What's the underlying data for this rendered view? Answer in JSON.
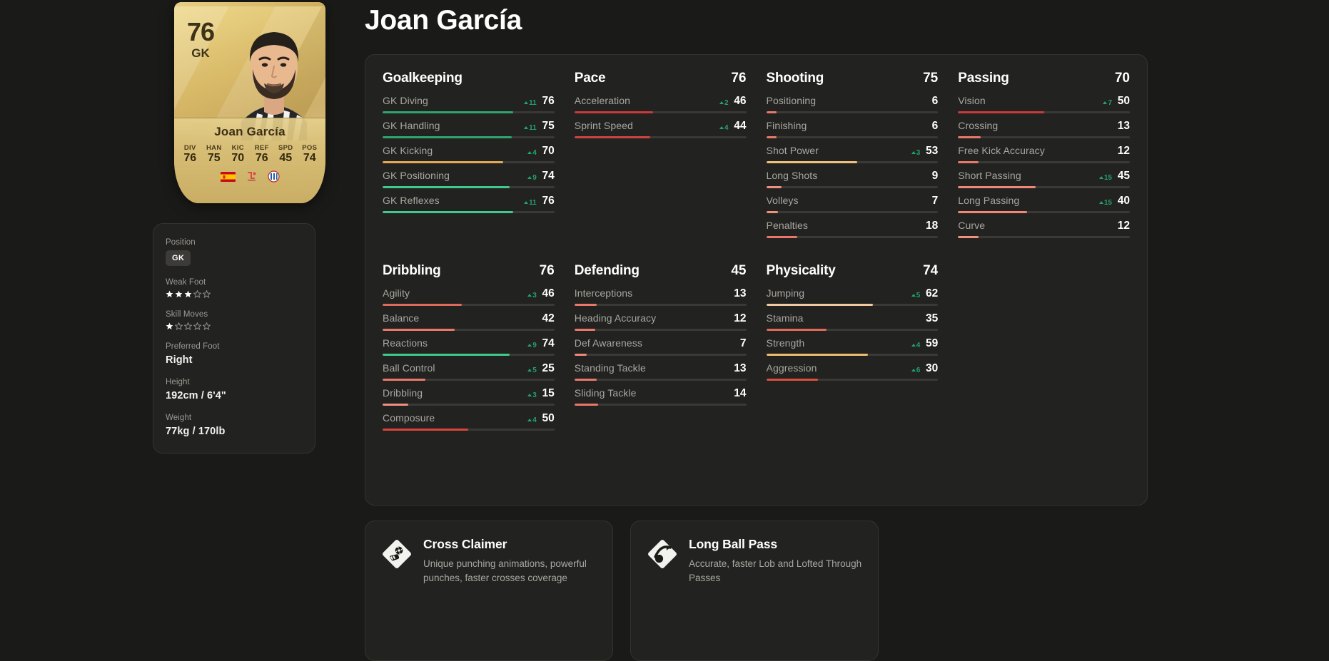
{
  "player": {
    "name": "Joan García",
    "card": {
      "rating": "76",
      "position": "GK",
      "name": "Joan García",
      "stats": [
        {
          "label": "DIV",
          "value": "76"
        },
        {
          "label": "HAN",
          "value": "75"
        },
        {
          "label": "KIC",
          "value": "70"
        },
        {
          "label": "REF",
          "value": "76"
        },
        {
          "label": "SPD",
          "value": "45"
        },
        {
          "label": "POS",
          "value": "74"
        }
      ],
      "badges": [
        "spain-flag-icon",
        "laliga-logo-icon",
        "espanyol-crest-icon"
      ]
    }
  },
  "info": {
    "position_label": "Position",
    "position_value": "GK",
    "weak_foot_label": "Weak Foot",
    "weak_foot_value": 3,
    "skill_moves_label": "Skill Moves",
    "skill_moves_value": 1,
    "star_max": 5,
    "preferred_foot_label": "Preferred Foot",
    "preferred_foot_value": "Right",
    "height_label": "Height",
    "height_value": "192cm / 6'4\"",
    "weight_label": "Weight",
    "weight_value": "77kg / 170lb"
  },
  "colors": {
    "green": "#2fa66e",
    "bright_green": "#3fc98a",
    "orange": "#e0a857",
    "light_orange": "#f0c07e",
    "red": "#c93a3a",
    "salmon": "#e8796a",
    "light_salmon": "#f0917f",
    "track": "#3a3935",
    "panel": "#222220",
    "background": "#1a1a18",
    "delta_green": "#23a36a"
  },
  "categories": [
    {
      "name": "Goalkeeping",
      "total": "",
      "stats": [
        {
          "name": "GK Diving",
          "value": 76,
          "delta": 11,
          "color": "#2fa66e"
        },
        {
          "name": "GK Handling",
          "value": 75,
          "delta": 11,
          "color": "#2fa66e"
        },
        {
          "name": "GK Kicking",
          "value": 70,
          "delta": 4,
          "color": "#e0a857"
        },
        {
          "name": "GK Positioning",
          "value": 74,
          "delta": 9,
          "color": "#3fc98a"
        },
        {
          "name": "GK Reflexes",
          "value": 76,
          "delta": 11,
          "color": "#3fc98a"
        }
      ]
    },
    {
      "name": "Pace",
      "total": "76",
      "stats": [
        {
          "name": "Acceleration",
          "value": 46,
          "delta": 2,
          "color": "#c93a3a"
        },
        {
          "name": "Sprint Speed",
          "value": 44,
          "delta": 4,
          "color": "#cf4343"
        }
      ]
    },
    {
      "name": "Shooting",
      "total": "75",
      "stats": [
        {
          "name": "Positioning",
          "value": 6,
          "delta": null,
          "color": "#e8796a"
        },
        {
          "name": "Finishing",
          "value": 6,
          "delta": null,
          "color": "#e8796a"
        },
        {
          "name": "Shot Power",
          "value": 53,
          "delta": 3,
          "color": "#f0c07e"
        },
        {
          "name": "Long Shots",
          "value": 9,
          "delta": null,
          "color": "#f0917f"
        },
        {
          "name": "Volleys",
          "value": 7,
          "delta": null,
          "color": "#f0917f"
        },
        {
          "name": "Penalties",
          "value": 18,
          "delta": null,
          "color": "#e8796a"
        }
      ]
    },
    {
      "name": "Passing",
      "total": "70",
      "stats": [
        {
          "name": "Vision",
          "value": 50,
          "delta": 7,
          "color": "#c93a3a"
        },
        {
          "name": "Crossing",
          "value": 13,
          "delta": null,
          "color": "#e8796a"
        },
        {
          "name": "Free Kick Accuracy",
          "value": 12,
          "delta": null,
          "color": "#e8796a"
        },
        {
          "name": "Short Passing",
          "value": 45,
          "delta": 15,
          "color": "#ef8878"
        },
        {
          "name": "Long Passing",
          "value": 40,
          "delta": 15,
          "color": "#ef8878"
        },
        {
          "name": "Curve",
          "value": 12,
          "delta": null,
          "color": "#f0917f"
        }
      ]
    },
    {
      "name": "Dribbling",
      "total": "76",
      "stats": [
        {
          "name": "Agility",
          "value": 46,
          "delta": 3,
          "color": "#e06a5a"
        },
        {
          "name": "Balance",
          "value": 42,
          "delta": null,
          "color": "#e8796a"
        },
        {
          "name": "Reactions",
          "value": 74,
          "delta": 9,
          "color": "#3fc98a"
        },
        {
          "name": "Ball Control",
          "value": 25,
          "delta": 5,
          "color": "#e8796a"
        },
        {
          "name": "Dribbling",
          "value": 15,
          "delta": 3,
          "color": "#f0917f"
        },
        {
          "name": "Composure",
          "value": 50,
          "delta": 4,
          "color": "#d9453c"
        }
      ]
    },
    {
      "name": "Defending",
      "total": "45",
      "stats": [
        {
          "name": "Interceptions",
          "value": 13,
          "delta": null,
          "color": "#e8796a"
        },
        {
          "name": "Heading Accuracy",
          "value": 12,
          "delta": null,
          "color": "#e8796a"
        },
        {
          "name": "Def Awareness",
          "value": 7,
          "delta": null,
          "color": "#ef8878"
        },
        {
          "name": "Standing Tackle",
          "value": 13,
          "delta": null,
          "color": "#e8796a"
        },
        {
          "name": "Sliding Tackle",
          "value": 14,
          "delta": null,
          "color": "#e8796a"
        }
      ]
    },
    {
      "name": "Physicality",
      "total": "74",
      "stats": [
        {
          "name": "Jumping",
          "value": 62,
          "delta": 5,
          "color": "#f3caa0"
        },
        {
          "name": "Stamina",
          "value": 35,
          "delta": null,
          "color": "#e06a5a"
        },
        {
          "name": "Strength",
          "value": 59,
          "delta": 4,
          "color": "#f0bb6e"
        },
        {
          "name": "Aggression",
          "value": 30,
          "delta": 6,
          "color": "#d9503f"
        }
      ]
    }
  ],
  "playstyles": [
    {
      "icon": "cross-claimer-icon",
      "title": "Cross Claimer",
      "description": "Unique punching animations, powerful punches, faster crosses coverage"
    },
    {
      "icon": "long-ball-pass-icon",
      "title": "Long Ball Pass",
      "description": "Accurate, faster Lob and Lofted Through Passes"
    }
  ]
}
